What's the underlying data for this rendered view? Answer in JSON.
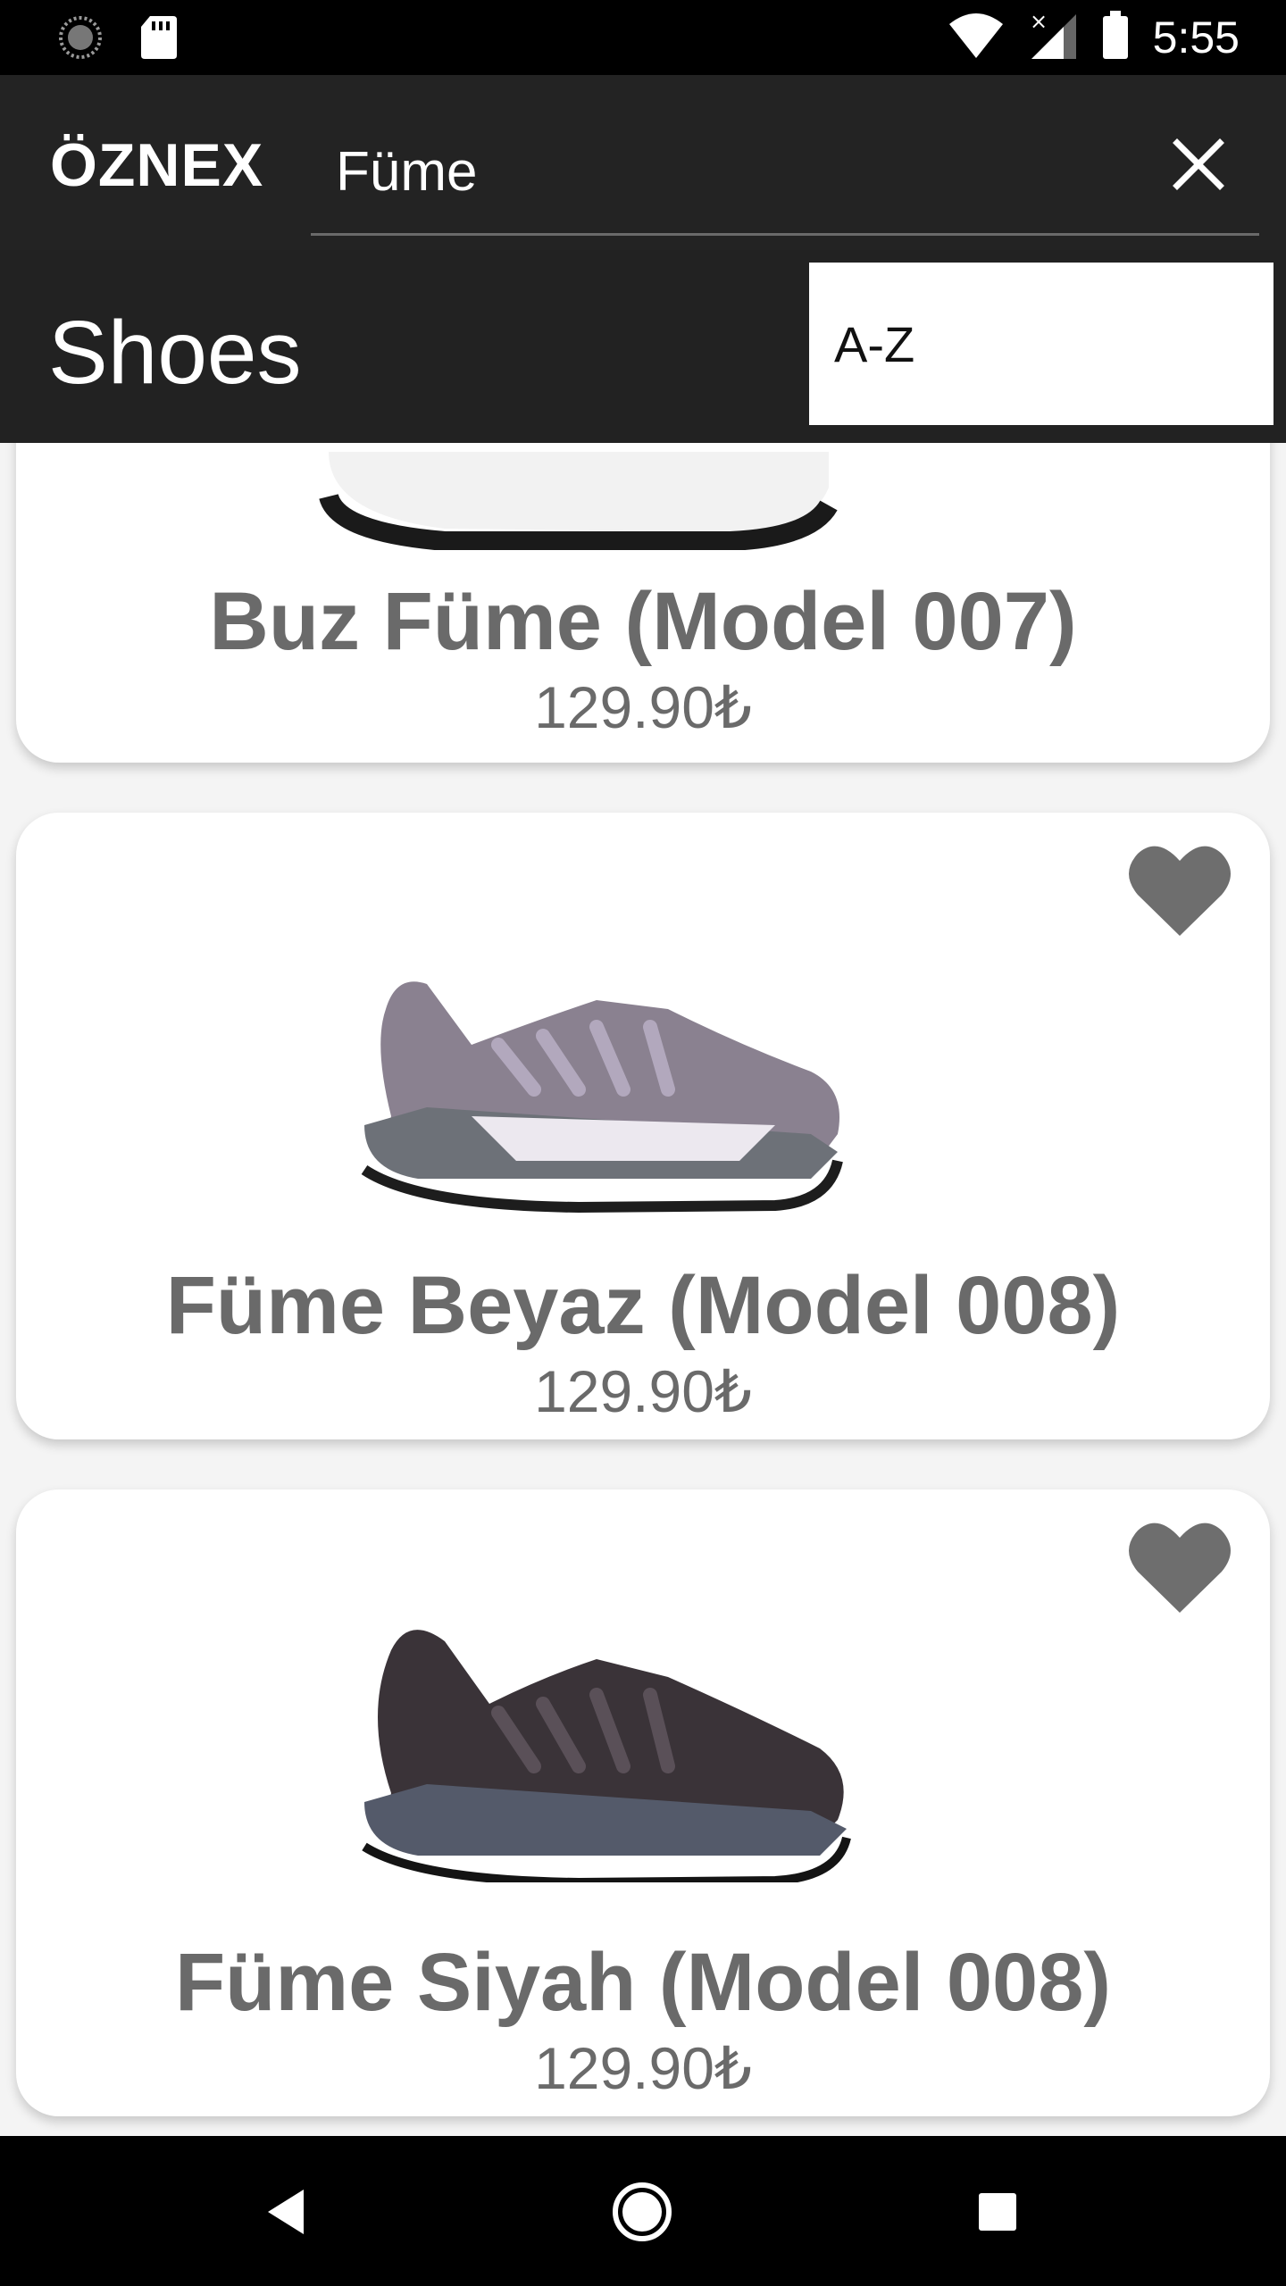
{
  "status_bar": {
    "time": "5:55",
    "icons": [
      "loading-icon",
      "sd-card-icon",
      "wifi-icon",
      "signal-icon",
      "battery-icon"
    ]
  },
  "app_bar": {
    "brand": "ÖZNEX",
    "search": {
      "value": "Füme",
      "placeholder": ""
    },
    "close_icon": "close-icon"
  },
  "category_bar": {
    "title": "Shoes",
    "sort": {
      "selected": "A-Z"
    }
  },
  "products": [
    {
      "name": "Buz Füme (Model 007)",
      "price": "129.90₺",
      "favorite": false
    },
    {
      "name": "Füme Beyaz (Model 008)",
      "price": "129.90₺",
      "favorite": true
    },
    {
      "name": "Füme Siyah (Model 008)",
      "price": "129.90₺",
      "favorite": true
    }
  ],
  "colors": {
    "app_bar": "#232323",
    "card_text": "#6a6a6a",
    "heart": "#6e6e6e",
    "background": "#f4f4f4"
  }
}
